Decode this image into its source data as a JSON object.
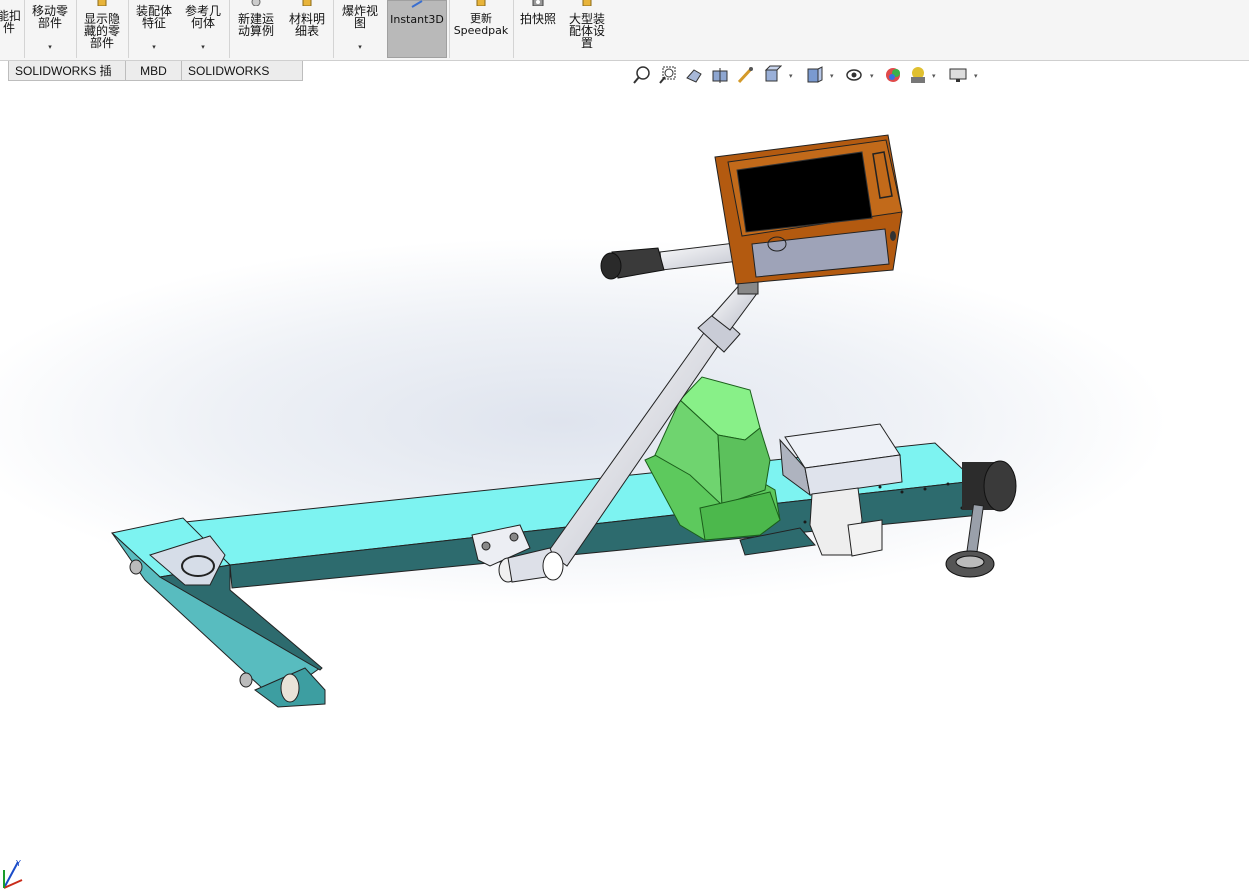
{
  "ribbon": {
    "items": [
      {
        "label": "能扣\n件",
        "has_dropdown": false
      },
      {
        "label": "移动零\n部件",
        "has_dropdown": true
      },
      {
        "label": "显示隐\n藏的零\n部件",
        "has_dropdown": false
      },
      {
        "label": "装配体\n特征",
        "has_dropdown": true
      },
      {
        "label": "参考几\n何体",
        "has_dropdown": true
      },
      {
        "label": "新建运\n动算例",
        "has_dropdown": false
      },
      {
        "label": "材料明\n细表",
        "has_dropdown": false
      },
      {
        "label": "爆炸视\n图",
        "has_dropdown": true
      },
      {
        "label": "Instant3D",
        "has_dropdown": false,
        "active": true
      },
      {
        "label": "更新\nSpeedpak",
        "has_dropdown": false
      },
      {
        "label": "拍快照",
        "has_dropdown": false
      },
      {
        "label": "大型装\n配体设\n置",
        "has_dropdown": false
      }
    ],
    "dropdown_glyph": "▾"
  },
  "tabs": [
    "SOLIDWORKS 插件",
    "MBD",
    "SOLIDWORKS CAM"
  ],
  "heads_up_toolbar": {
    "icons": [
      "zoom-to-fit-icon",
      "zoom-to-area-icon",
      "previous-view-icon",
      "section-view-icon",
      "dynamic-annotation-icon",
      "view-orientation-icon",
      "display-style-icon",
      "hide-show-items-icon",
      "edit-appearance-icon",
      "apply-scene-icon",
      "view-settings-icon"
    ],
    "dropdown_glyph": "▾"
  },
  "colors": {
    "frame": "#7df3f1",
    "frame_dark": "#2d6b6e",
    "screen_housing": "#b35a10",
    "screen": "#000000",
    "motor_box": "#6fd46f",
    "control_box": "#e3e8f2",
    "active_ribbon": "#b9b9b9"
  }
}
